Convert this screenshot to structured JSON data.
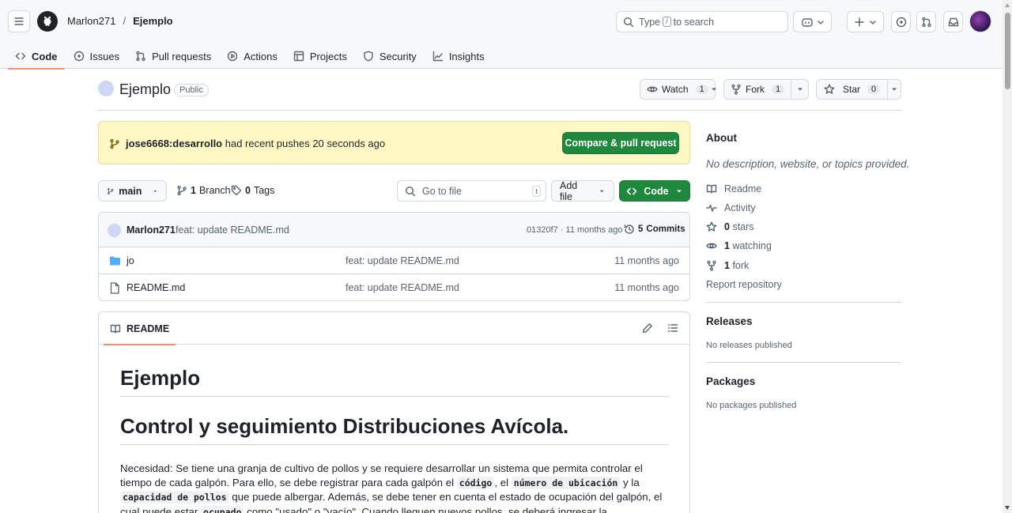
{
  "header": {
    "owner": "Marlon271",
    "separator": "/",
    "repo": "Ejemplo",
    "search_pre": "Type",
    "search_key": "/",
    "search_post": "to search"
  },
  "tabs": [
    {
      "label": "Code",
      "icon": "code-icon"
    },
    {
      "label": "Issues",
      "icon": "issue-icon"
    },
    {
      "label": "Pull requests",
      "icon": "pull-request-icon"
    },
    {
      "label": "Actions",
      "icon": "play-icon"
    },
    {
      "label": "Projects",
      "icon": "table-icon"
    },
    {
      "label": "Security",
      "icon": "shield-icon"
    },
    {
      "label": "Insights",
      "icon": "graph-icon"
    }
  ],
  "repo_head": {
    "name": "Ejemplo",
    "visibility": "Public",
    "watch_label": "Watch",
    "watch_count": "1",
    "fork_label": "Fork",
    "fork_count": "1",
    "star_label": "Star",
    "star_count": "0"
  },
  "banner": {
    "branch": "jose6668:desarrollo",
    "text": "had recent pushes 20 seconds ago",
    "button": "Compare & pull request"
  },
  "branch_bar": {
    "branch": "main",
    "branches_count": "1",
    "branches_label": "Branch",
    "tags_count": "0",
    "tags_label": "Tags",
    "goto_placeholder": "Go to file",
    "goto_key": "t",
    "add_file": "Add file",
    "code_button": "Code"
  },
  "latest_commit": {
    "user": "Marlon271",
    "message": "feat: update README.md",
    "hash_time": "01320f7 · 11 months ago",
    "commits_count": "5",
    "commits_label": "Commits"
  },
  "files": [
    {
      "name": "jo",
      "type": "folder",
      "message": "feat: update README.md",
      "date": "11 months ago"
    },
    {
      "name": "README.md",
      "type": "file",
      "message": "feat: update README.md",
      "date": "11 months ago"
    }
  ],
  "readme": {
    "tab": "README",
    "h1": "Ejemplo",
    "h1b": "Control y seguimiento Distribuciones Avícola.",
    "p1": "Necesidad: Se tiene una granja de cultivo de pollos y se requiere desarrollar un sistema que permita controlar el tiempo de cada galpón. Para ello, se debe registrar para cada galpón el ",
    "c1": "código",
    "p2": ", el ",
    "c2": "número de ubicación",
    "p3": " y la ",
    "c3": "capacidad de pollos",
    "p4": " que puede albergar. Además, se debe tener en cuenta el estado de ocupación del galpón, el cual puede estar ",
    "c4": "ocupado",
    "p5": " como \"usado\" o \"vacío\". Cuando lleguen nuevos pollos, se deberá ingresar la"
  },
  "sidebar": {
    "about": "About",
    "description": "No description, website, or topics provided.",
    "readme": "Readme",
    "activity": "Activity",
    "stars_count": "0",
    "stars_label": "stars",
    "watching_count": "1",
    "watching_label": "watching",
    "fork_count": "1",
    "fork_label": "fork",
    "report": "Report repository",
    "releases": "Releases",
    "releases_empty": "No releases published",
    "packages": "Packages",
    "packages_empty": "No packages published"
  },
  "colors": {
    "accent_green": "#1f883d",
    "tab_underline": "#fd8c73",
    "banner_bg": "#fff8c5",
    "folder_blue": "#54aeff"
  }
}
